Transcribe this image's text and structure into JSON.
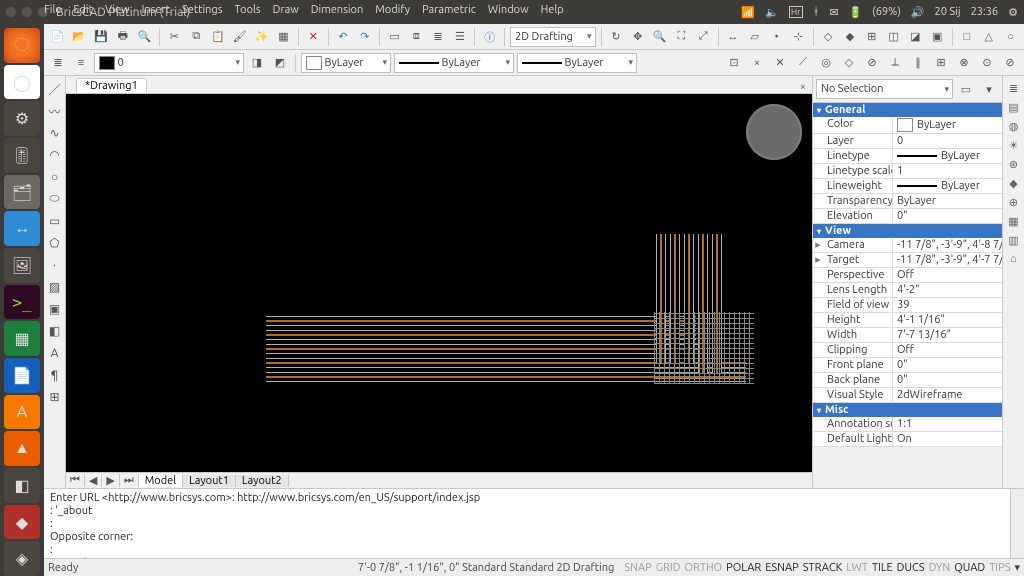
{
  "system": {
    "title": "BricsCAD Platinum (Trial)",
    "keyboard": "Hr",
    "battery": "(69%)",
    "date": "20 Sij",
    "time": "23:36"
  },
  "menu": [
    "File",
    "Edit",
    "View",
    "Insert",
    "Settings",
    "Tools",
    "Draw",
    "Dimension",
    "Modify",
    "Parametric",
    "Window",
    "Help"
  ],
  "workspace_combo": "2D Drafting",
  "layer_row": {
    "layer": "0",
    "bylayer1": "ByLayer",
    "bylayer2": "ByLayer",
    "bylayer3": "ByLayer"
  },
  "doc_tab": "*Drawing1",
  "layout_tabs": [
    "Model",
    "Layout1",
    "Layout2"
  ],
  "command": {
    "line1": "Enter URL <http://www.bricsys.com>: http://www.bricsys.com/en_US/support/index.jsp",
    "line2": ": '_about",
    "line3": ":",
    "line4": "Opposite corner:",
    "line5": ":",
    "prompt": "Opposite corner:"
  },
  "status": {
    "ready": "Ready",
    "coords": "7'-0 7/8\", -1 1/16\", 0\"  Standard  Standard  2D Drafting",
    "toggles": [
      {
        "t": "SNAP",
        "on": false
      },
      {
        "t": "GRID",
        "on": false
      },
      {
        "t": "ORTHO",
        "on": false
      },
      {
        "t": "POLAR",
        "on": true
      },
      {
        "t": "ESNAP",
        "on": true
      },
      {
        "t": "STRACK",
        "on": true
      },
      {
        "t": "LWT",
        "on": false
      },
      {
        "t": "TILE",
        "on": true
      },
      {
        "t": "DUCS",
        "on": true
      },
      {
        "t": "DYN",
        "on": false
      },
      {
        "t": "QUAD",
        "on": true
      },
      {
        "t": "TIPS",
        "on": false
      }
    ]
  },
  "props": {
    "selection": "No Selection",
    "sections": [
      {
        "name": "General",
        "rows": [
          {
            "k": "Color",
            "v": "ByLayer",
            "swatch": "#ffffff"
          },
          {
            "k": "Layer",
            "v": "0"
          },
          {
            "k": "Linetype",
            "v": "ByLayer",
            "line": true
          },
          {
            "k": "Linetype scale",
            "v": "1"
          },
          {
            "k": "Lineweight",
            "v": "ByLayer",
            "line": true
          },
          {
            "k": "Transparency",
            "v": "ByLayer"
          },
          {
            "k": "Elevation",
            "v": "0\""
          }
        ]
      },
      {
        "name": "View",
        "rows": [
          {
            "k": "Camera",
            "v": "-11 7/8\", -3'-9\", 4'-8 7/8\"",
            "arrow": true
          },
          {
            "k": "Target",
            "v": "-11 7/8\", -3'-9\", 4'-7 7/8\"",
            "arrow": true
          },
          {
            "k": "Perspective",
            "v": "Off"
          },
          {
            "k": "Lens Length",
            "v": "4'-2\""
          },
          {
            "k": "Field of view",
            "v": "39"
          },
          {
            "k": "Height",
            "v": "4'-1 1/16\""
          },
          {
            "k": "Width",
            "v": "7'-7 13/16\""
          },
          {
            "k": "Clipping",
            "v": "Off"
          },
          {
            "k": "Front plane",
            "v": "0\""
          },
          {
            "k": "Back plane",
            "v": "0\""
          },
          {
            "k": "Visual Style",
            "v": "2dWireframe"
          }
        ]
      },
      {
        "name": "Misc",
        "rows": [
          {
            "k": "Annotation sca",
            "v": "1:1"
          },
          {
            "k": "Default Lightin",
            "v": "On"
          }
        ]
      }
    ]
  }
}
